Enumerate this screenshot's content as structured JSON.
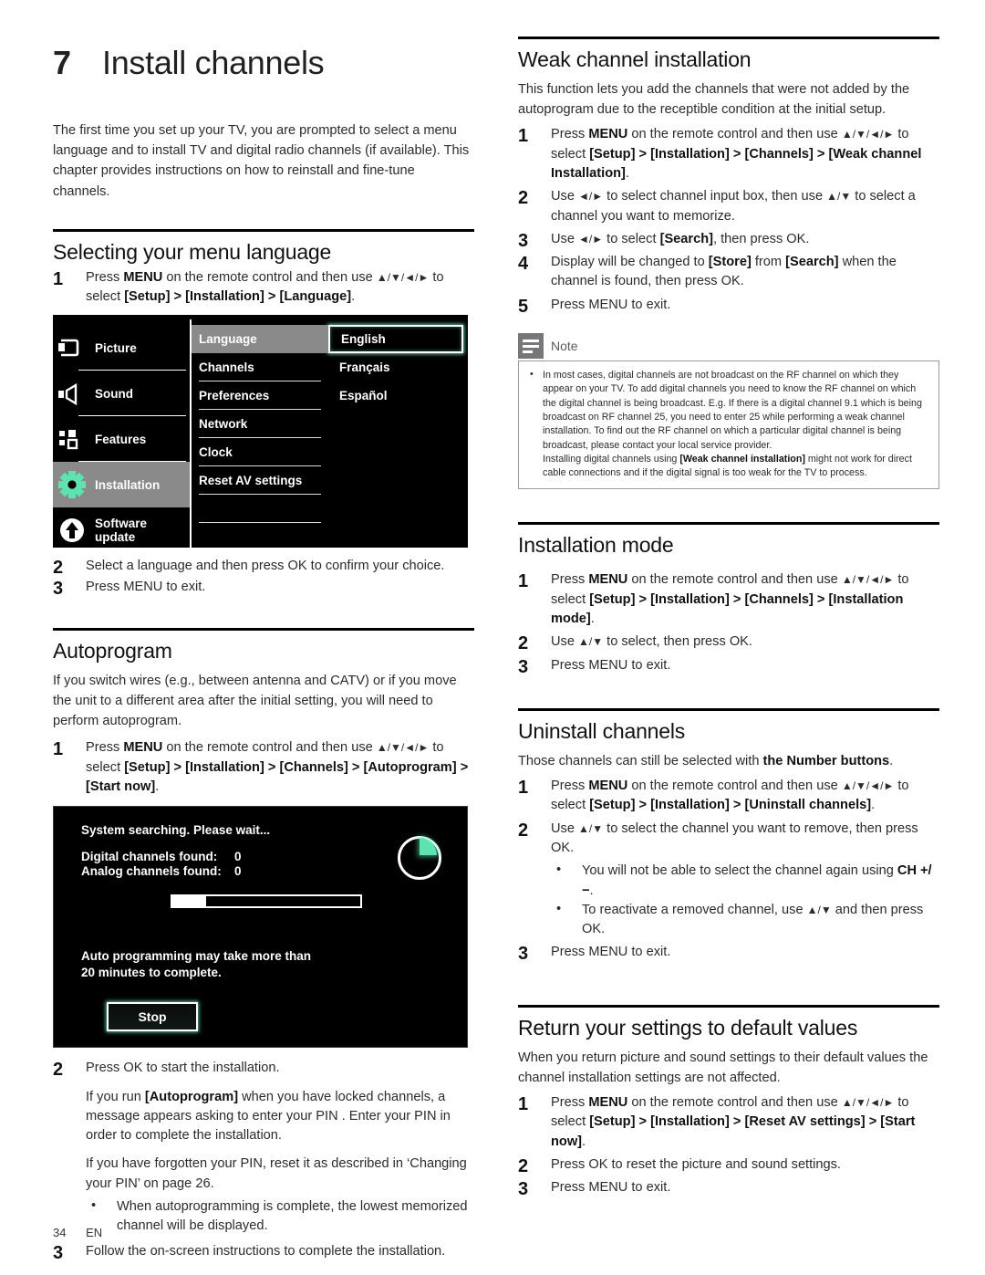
{
  "chapter": {
    "number": "7",
    "title": "Install channels",
    "intro": "The first time you set up your TV, you are prompted to select a menu language and to install TV and digital radio channels (if available). This chapter provides instructions on how to reinstall and fine-tune channels."
  },
  "menu_language": {
    "title": "Selecting your menu language",
    "step1_a": "Press ",
    "step1_menu": "MENU",
    "step1_b": " on the remote control and then use ",
    "step1_arrows": "▲/▼/◄/►",
    "step1_c": " to select ",
    "step1_path": "[Setup] > [Installation] > [Language]",
    "step1_d": ".",
    "step2": "Select a language and then press OK to confirm your choice.",
    "step3": "Press MENU to exit.",
    "numbers": {
      "n1": "1",
      "n2": "2",
      "n3": "3"
    }
  },
  "tv_menu": {
    "left_items": [
      {
        "label": "Picture",
        "icon": "picture-icon",
        "selected": false
      },
      {
        "label": "Sound",
        "icon": "sound-icon",
        "selected": false
      },
      {
        "label": "Features",
        "icon": "features-icon",
        "selected": false
      },
      {
        "label": "Installation",
        "icon": "gear-icon",
        "selected": true
      },
      {
        "label": "Software update",
        "icon": "upload-arrow-icon",
        "selected": false
      }
    ],
    "mid_items": [
      {
        "label": "Language",
        "selected": true
      },
      {
        "label": "Channels",
        "selected": false
      },
      {
        "label": "Preferences",
        "selected": false
      },
      {
        "label": "Network",
        "selected": false
      },
      {
        "label": "Clock",
        "selected": false
      },
      {
        "label": "Reset AV settings",
        "selected": false
      }
    ],
    "options": [
      {
        "label": "English",
        "selected": true
      },
      {
        "label": "Français",
        "selected": false
      },
      {
        "label": "Español",
        "selected": false
      }
    ],
    "highlight_color": "#5ce3b0",
    "selected_bg": "#8a8a8a"
  },
  "autoprogram": {
    "title": "Autoprogram",
    "body": "If you switch wires (e.g., between antenna and CATV) or if you move the unit to a different area after the initial setting, you will need to perform autoprogram.",
    "step1_a": "Press ",
    "step1_menu": "MENU",
    "step1_b": " on the remote control and then use ",
    "step1_arrows": "▲/▼/◄/►",
    "step1_c": " to select ",
    "step1_path": "[Setup] > [Installation] > [Channels] > [Autoprogram] > [Start now]",
    "step1_d": ".",
    "step2": "Press OK to start the installation.",
    "para1_a": "If you run ",
    "para1_kw": "[Autoprogram]",
    "para1_b": " when you have locked channels, a message appears asking to enter your PIN . Enter your PIN in order to complete the installation.",
    "para2": "If you have forgotten your PIN, reset it as described in ‘Changing your PIN’ on page 26.",
    "bullet1": "When autoprogramming is complete, the lowest memorized channel will be displayed.",
    "step3": "Follow the on-screen instructions to complete the installation.",
    "numbers": {
      "n1": "1",
      "n2": "2",
      "n3": "3"
    }
  },
  "search_dialog": {
    "title": "System searching. Please wait...",
    "digital_label": "Digital channels found:",
    "digital_value": "0",
    "analog_label": "Analog channels found:",
    "analog_value": "0",
    "progress_percent": 18,
    "note_line1": "Auto programming may take more than",
    "note_line2": "20 minutes to complete.",
    "stop_button": "Stop",
    "spinner": "loading-spinner-icon"
  },
  "weak_channel": {
    "title": "Weak channel installation",
    "body": "This function lets you add the channels that were not added by the autoprogram due to the receptible condition at the initial setup.",
    "step1_a": "Press ",
    "step1_menu": "MENU",
    "step1_b": " on the remote control and then use ",
    "step1_arrows": "▲/▼/◄/►",
    "step1_c": " to select ",
    "step1_path": "[Setup] > [Installation] > [Channels] > [Weak channel Installation]",
    "step1_d": ".",
    "step2_a": "Use ",
    "step2_arrows1": "◄/►",
    "step2_b": " to select channel input box, then use ",
    "step2_arrows2": "▲/▼",
    "step2_c": " to select a channel you want to memorize.",
    "step3_a": "Use ",
    "step3_arrows": "◄/►",
    "step3_b": " to select ",
    "step3_kw": "[Search]",
    "step3_c": ", then press OK.",
    "step4_a": "Display will be changed to ",
    "step4_kw1": "[Store]",
    "step4_b": " from ",
    "step4_kw2": "[Search]",
    "step4_c": " when the channel is found, then press OK.",
    "step5": "Press MENU to exit.",
    "numbers": {
      "n1": "1",
      "n2": "2",
      "n3": "3",
      "n4": "4",
      "n5": "5"
    }
  },
  "note": {
    "label": "Note",
    "icon": "note-icon",
    "bullet1_a": "In most cases, digital channels are not broadcast on the RF channel on which they appear on your TV. To add digital channels you need to know the RF channel on which the digital channel is being broadcast. E.g. If there is a digital channel 9.1 which is being broadcast on RF channel 25, you need to enter 25 while performing a weak channel installation. To find out the RF channel on which a particular digital channel is being broadcast, please contact your local service provider.",
    "bullet1_b": "Installing digital channels using ",
    "bullet1_kw": "[Weak channel installation]",
    "bullet1_c": " might not work for direct cable connections and if the digital signal is too weak for the TV to process."
  },
  "installation_mode": {
    "title": "Installation mode",
    "step1_a": "Press ",
    "step1_menu": "MENU",
    "step1_b": " on the remote control and then use ",
    "step1_arrows": "▲/▼/◄/►",
    "step1_c": " to select ",
    "step1_path": "[Setup] > [Installation] > [Channels] > [Installation mode]",
    "step1_d": ".",
    "step2_a": "Use ",
    "step2_arrows": "▲/▼",
    "step2_b": " to select, then press OK.",
    "step3": "Press MENU to exit.",
    "numbers": {
      "n1": "1",
      "n2": "2",
      "n3": "3"
    }
  },
  "uninstall_channels": {
    "title": "Uninstall channels",
    "body_a": "Those channels can still be selected with ",
    "body_kw": "the Number buttons",
    "body_b": ".",
    "step1_a": "Press ",
    "step1_menu": "MENU",
    "step1_b": " on the remote control and then use ",
    "step1_arrows": "▲/▼/◄/►",
    "step1_c": " to select ",
    "step1_path": "[Setup] > [Installation] > [Uninstall channels]",
    "step1_d": ".",
    "step2_a": "Use ",
    "step2_arrows": "▲/▼",
    "step2_b": " to select the channel you want to remove, then press OK.",
    "bullet1_a": "You will not be able to select the channel again using ",
    "bullet1_kw": "CH +/−",
    "bullet1_b": ".",
    "bullet2_a": "To reactivate a removed channel, use ",
    "bullet2_arrows": "▲/▼",
    "bullet2_b": " and then press OK.",
    "step3": "Press MENU to exit.",
    "numbers": {
      "n1": "1",
      "n2": "2",
      "n3": "3"
    }
  },
  "reset_defaults": {
    "title": "Return your settings to default values",
    "body": "When you return picture and sound settings to their default values the channel installation settings are not affected.",
    "step1_a": "Press ",
    "step1_menu": "MENU",
    "step1_b": " on the remote control and then use ",
    "step1_arrows": "▲/▼/◄/►",
    "step1_c": " to select ",
    "step1_path": "[Setup] > [Installation] > [Reset AV settings] > [Start now]",
    "step1_d": ".",
    "step2": "Press OK to reset the picture and sound settings.",
    "step3": "Press MENU to exit.",
    "numbers": {
      "n1": "1",
      "n2": "2",
      "n3": "3"
    }
  },
  "footer": {
    "page": "34",
    "lang": "EN"
  }
}
